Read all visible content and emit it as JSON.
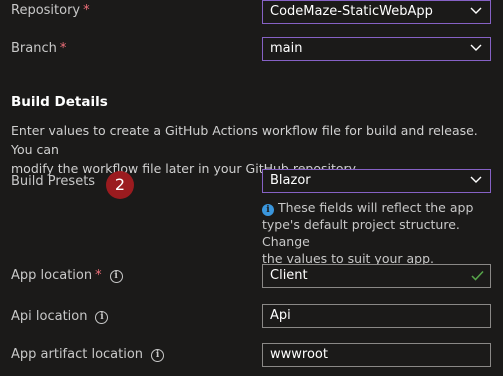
{
  "repository": {
    "label": "Repository",
    "required": "*",
    "value": "CodeMaze-StaticWebApp"
  },
  "branch": {
    "label": "Branch",
    "required": "*",
    "value": "main"
  },
  "build_details": {
    "heading": "Build Details",
    "description_line1": "Enter values to create a GitHub Actions workflow file for build and release. You can",
    "description_line2": "modify the workflow file later in your GitHub repository."
  },
  "build_presets": {
    "label": "Build Presets",
    "value": "Blazor",
    "step_badge": "2",
    "hint_lines": [
      "These fields will reflect the app",
      "type's default project structure. Change",
      "the values to suit your app."
    ]
  },
  "app_location": {
    "label": "App location",
    "required": "*",
    "value": "Client"
  },
  "api_location": {
    "label": "Api location",
    "value": "Api"
  },
  "app_artifact_location": {
    "label": "App artifact location",
    "value": "wwwroot"
  },
  "icons": {
    "info": "i",
    "chevron": "chevron-down-icon",
    "check": "checkmark-icon"
  },
  "colors": {
    "accent": "#8661c5",
    "required": "#f1707b",
    "badge": "#9b1b1f",
    "check": "#57a64a",
    "hint_icon": "#3a96dd"
  }
}
